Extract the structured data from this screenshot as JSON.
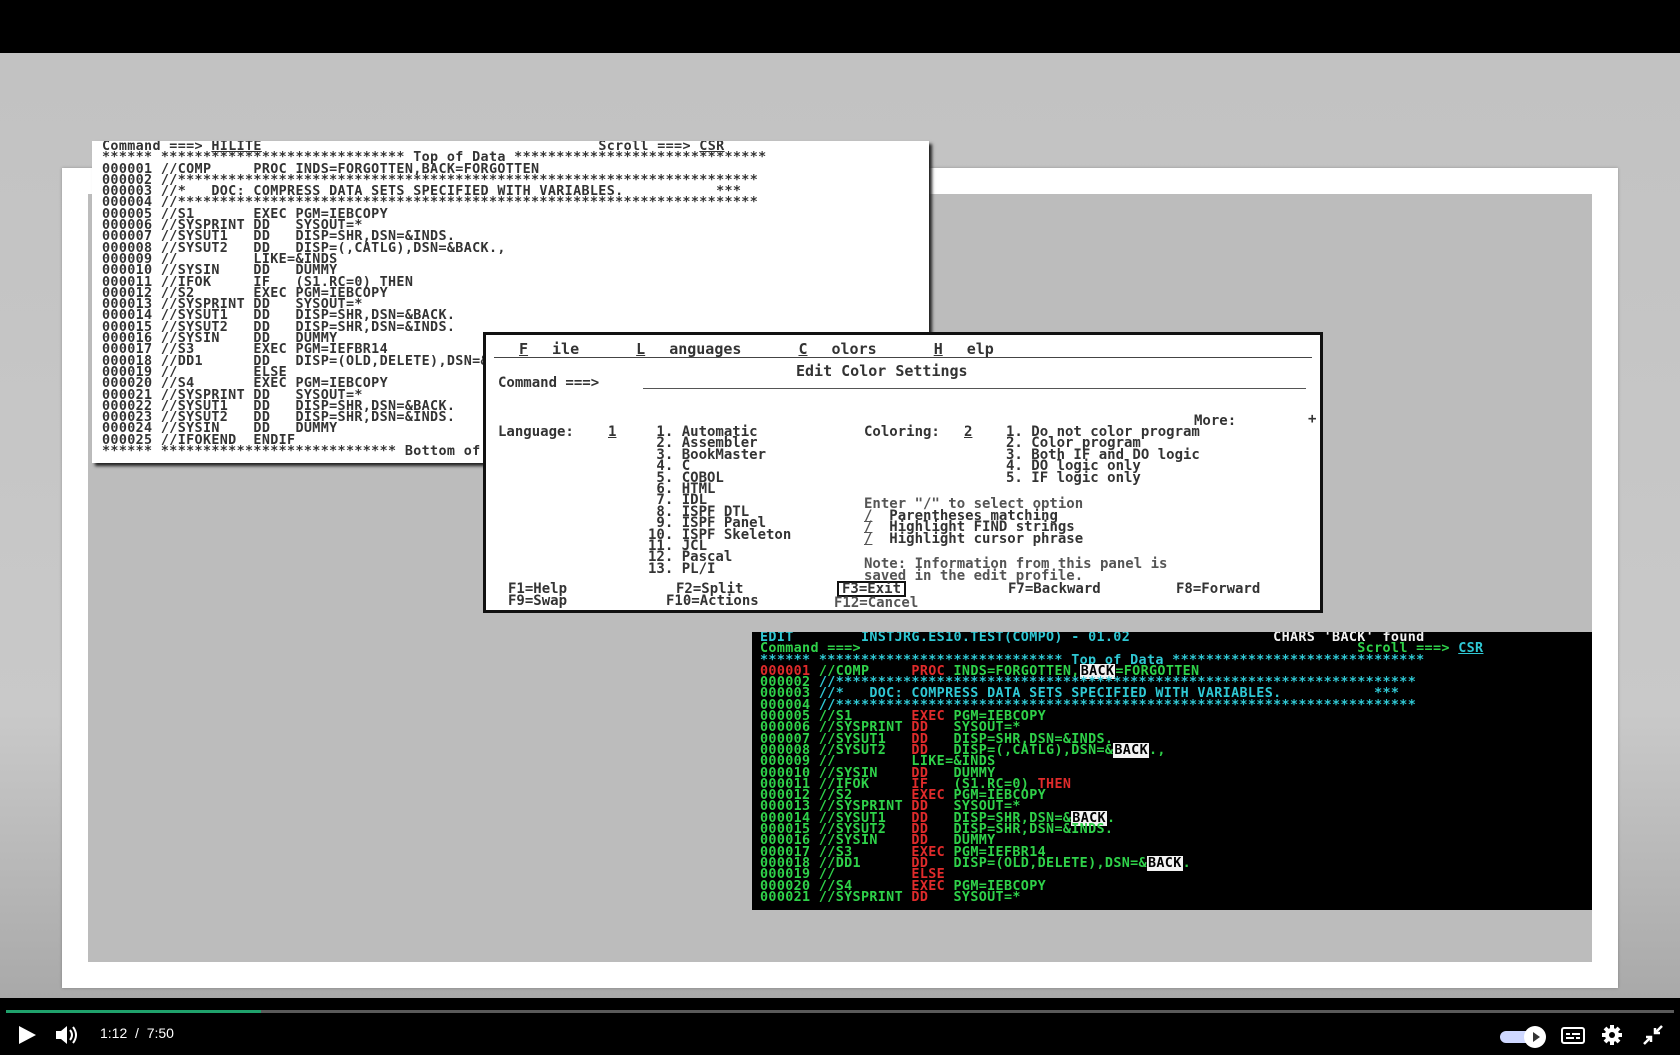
{
  "player": {
    "current_time": "1:12",
    "separator": "/",
    "duration": "7:50",
    "progress_fraction": 0.153,
    "accent_color": "#1fa16b"
  },
  "panel_plain": {
    "header": {
      "command_label": "Command ===>",
      "command_value": "HILITE",
      "scroll_label": "Scroll ===>",
      "scroll_value": "CSR"
    },
    "lines": [
      "****** ***************************** Top of Data ******************************",
      "000001 //COMP     PROC INDS=FORGOTTEN,BACK=FORGOTTEN",
      "000002 //*********************************************************************",
      "000003 //*   DOC: COMPRESS DATA SETS SPECIFIED WITH VARIABLES.           ***",
      "000004 //*********************************************************************",
      "000005 //S1       EXEC PGM=IEBCOPY",
      "000006 //SYSPRINT DD   SYSOUT=*",
      "000007 //SYSUT1   DD   DISP=SHR,DSN=&INDS.",
      "000008 //SYSUT2   DD   DISP=(,CATLG),DSN=&BACK.,",
      "000009 //         LIKE=&INDS",
      "000010 //SYSIN    DD   DUMMY",
      "000011 //IFOK     IF   (S1.RC=0) THEN",
      "000012 //S2       EXEC PGM=IEBCOPY",
      "000013 //SYSPRINT DD   SYSOUT=*",
      "000014 //SYSUT1   DD   DISP=SHR,DSN=&BACK.",
      "000015 //SYSUT2   DD   DISP=SHR,DSN=&INDS.",
      "000016 //SYSIN    DD   DUMMY",
      "000017 //S3       EXEC PGM=IEFBR14",
      "000018 //DD1      DD   DISP=(OLD,DELETE),DSN=&BACK.",
      "000019 //         ELSE",
      "000020 //S4       EXEC PGM=IEBCOPY",
      "000021 //SYSPRINT DD   SYSOUT=*",
      "000022 //SYSUT1   DD   DISP=SHR,DSN=&BACK.",
      "000023 //SYSUT2   DD   DISP=SHR,DSN=&INDS.",
      "000024 //SYSIN    DD   DUMMY",
      "000025 //IFOKEND  ENDIF",
      "****** **************************** Bottom of Data ****************************"
    ]
  },
  "dialog": {
    "menu": [
      "File",
      "Languages",
      "Colors",
      "Help"
    ],
    "menu_hotkeys": [
      "F",
      "L",
      "C",
      "H"
    ],
    "menu_rest": [
      "ile",
      "anguages",
      "olors",
      "elp"
    ],
    "title": "Edit Color Settings",
    "command_label": "Command ===>",
    "more_label": "More:",
    "more_marker": "+",
    "language_label": "Language:",
    "language_value": "1",
    "languages": [
      " 1. Automatic",
      " 2. Assembler",
      " 3. BookMaster",
      " 4. C",
      " 5. COBOL",
      " 6. HTML",
      " 7. IDL",
      " 8. ISPF DTL",
      " 9. ISPF Panel",
      "10. ISPF Skeleton",
      "11. JCL",
      "12. Pascal",
      "13. PL/I"
    ],
    "coloring_label": "Coloring:",
    "coloring_value": "2",
    "coloring_options": [
      "1. Do not color program",
      "2. Color program",
      "3. Both IF and DO logic",
      "4. DO logic only",
      "5. IF logic only"
    ],
    "select_hint": "Enter \"/\" to select option",
    "check_mark": "/",
    "checkboxes": [
      "Parentheses matching",
      "Highlight FIND strings",
      "Highlight cursor phrase"
    ],
    "note_line1": "Note: Information from this panel is",
    "note_line2": "saved in the edit profile.",
    "fkeys_row1": {
      "help": "F1=Help",
      "split": "F2=Split",
      "exit": "F3=Exit",
      "backward": "F7=Backward",
      "forward": "F8=Forward"
    },
    "fkeys_row2": {
      "swap": "F9=Swap",
      "actions": "F10=Actions",
      "cancel": "F12=Cancel"
    }
  },
  "panel_color": {
    "edit_label": "EDIT",
    "dataset": "INSTJRG.ES10.TEST(COMPO) - 01.02",
    "status": "CHARS 'BACK' found",
    "command_label": "Command ===>",
    "scroll_label": "Scroll ===>",
    "scroll_value": "CSR",
    "top_line": "****** ***************************** Top of Data ******************************",
    "highlight_word": "BACK",
    "colors": {
      "green": "#2fd24a",
      "red": "#e02b2b",
      "white": "#f2f2f2",
      "cyan": "#2fc8d4"
    }
  }
}
